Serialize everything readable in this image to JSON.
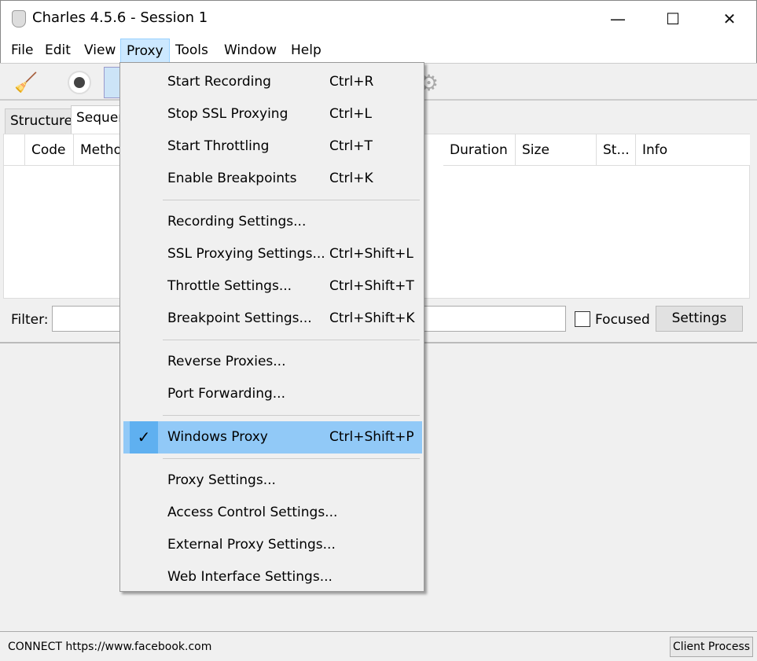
{
  "window": {
    "title": "Charles 4.5.6 - Session 1",
    "minimize": "—",
    "maximize": "☐",
    "close": "✕"
  },
  "menubar": [
    "File",
    "Edit",
    "View",
    "Proxy",
    "Tools",
    "Window",
    "Help"
  ],
  "tabs": [
    "Structure",
    "Sequence"
  ],
  "table": {
    "columns": [
      "Code",
      "Method",
      "Duration",
      "Size",
      "St...",
      "Info"
    ]
  },
  "filter": {
    "label": "Filter:",
    "value": "",
    "focused_label": "Focused",
    "focused_checked": false,
    "settings_label": "Settings"
  },
  "proxy_menu": {
    "groups": [
      [
        {
          "label": "Start Recording",
          "shortcut": "Ctrl+R"
        },
        {
          "label": "Stop SSL Proxying",
          "shortcut": "Ctrl+L"
        },
        {
          "label": "Start Throttling",
          "shortcut": "Ctrl+T"
        },
        {
          "label": "Enable Breakpoints",
          "shortcut": "Ctrl+K"
        }
      ],
      [
        {
          "label": "Recording Settings...",
          "shortcut": ""
        },
        {
          "label": "SSL Proxying Settings...",
          "shortcut": "Ctrl+Shift+L"
        },
        {
          "label": "Throttle Settings...",
          "shortcut": "Ctrl+Shift+T"
        },
        {
          "label": "Breakpoint Settings...",
          "shortcut": "Ctrl+Shift+K"
        }
      ],
      [
        {
          "label": "Reverse Proxies...",
          "shortcut": ""
        },
        {
          "label": "Port Forwarding...",
          "shortcut": ""
        }
      ],
      [
        {
          "label": "Windows Proxy",
          "shortcut": "Ctrl+Shift+P",
          "checked": true,
          "highlighted": true
        }
      ],
      [
        {
          "label": "Proxy Settings...",
          "shortcut": ""
        },
        {
          "label": "Access Control Settings...",
          "shortcut": ""
        },
        {
          "label": "External Proxy Settings...",
          "shortcut": ""
        },
        {
          "label": "Web Interface Settings...",
          "shortcut": ""
        }
      ]
    ]
  },
  "status": {
    "text": "CONNECT https://www.facebook.com",
    "client_process": "Client Process"
  },
  "colors": {
    "highlight": "#91c9f7",
    "check_bg": "#5fb0f0",
    "menu_active": "#cce8ff"
  }
}
